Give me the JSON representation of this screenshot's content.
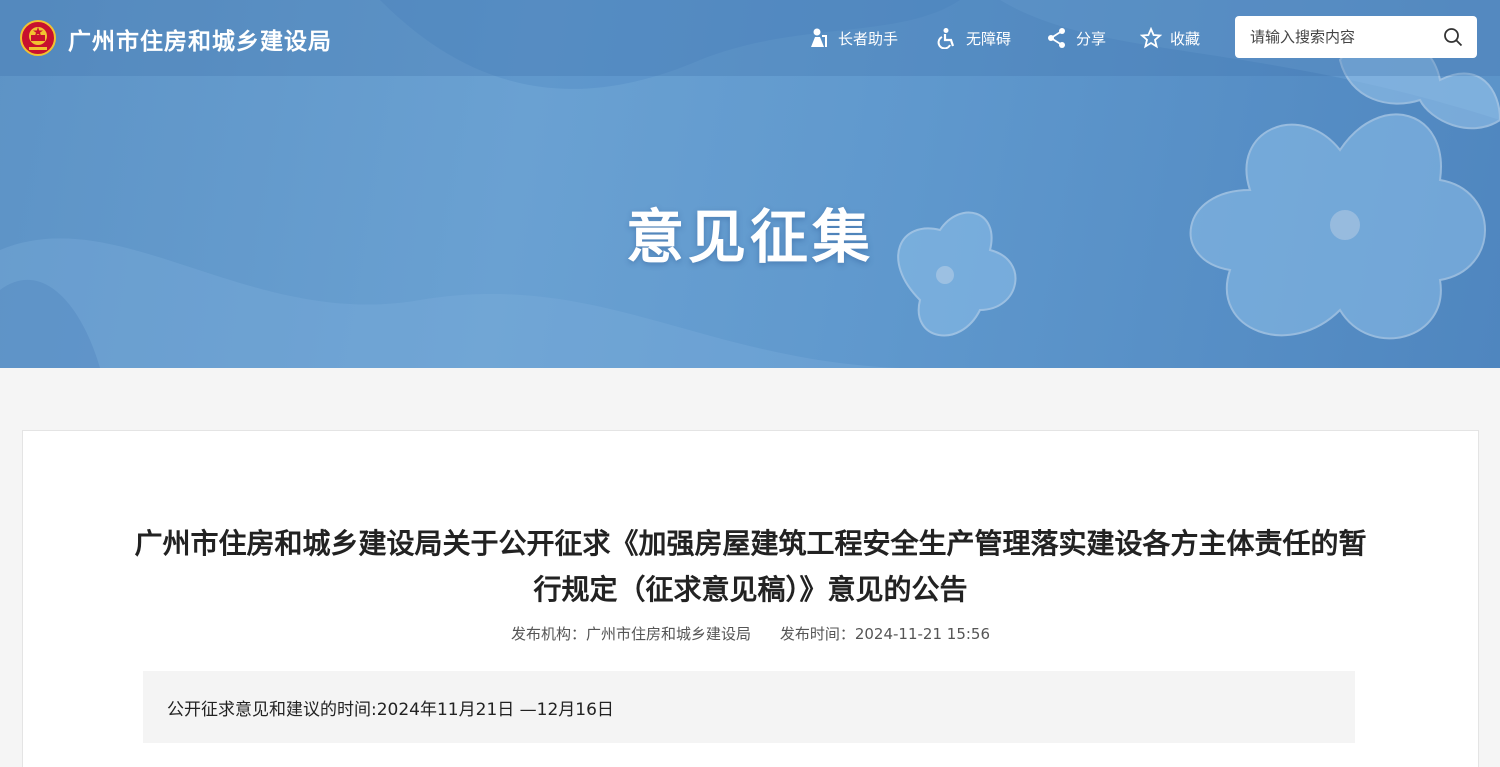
{
  "header": {
    "site_title": "广州市住房和城乡建设局",
    "nav": [
      {
        "label": "长者助手",
        "icon": "elder-assist-icon"
      },
      {
        "label": "无障碍",
        "icon": "accessibility-icon"
      },
      {
        "label": "分享",
        "icon": "share-icon"
      },
      {
        "label": "收藏",
        "icon": "star-icon"
      }
    ],
    "search": {
      "placeholder": "请输入搜索内容",
      "value": ""
    }
  },
  "banner": {
    "title": "意见征集"
  },
  "article": {
    "title": "广州市住房和城乡建设局关于公开征求《加强房屋建筑工程安全生产管理落实建设各方主体责任的暂行规定（征求意见稿）》意见的公告",
    "publisher_label": "发布机构：",
    "publisher": "广州市住房和城乡建设局",
    "time_label": "发布时间：",
    "time": "2024-11-21 15:56",
    "notice": "公开征求意见和建议的时间:2024年11月21日 —12月16日"
  },
  "colors": {
    "banner_blue": "#5f98cd",
    "emblem_red": "#c8102e",
    "emblem_gold": "#f2c230"
  }
}
